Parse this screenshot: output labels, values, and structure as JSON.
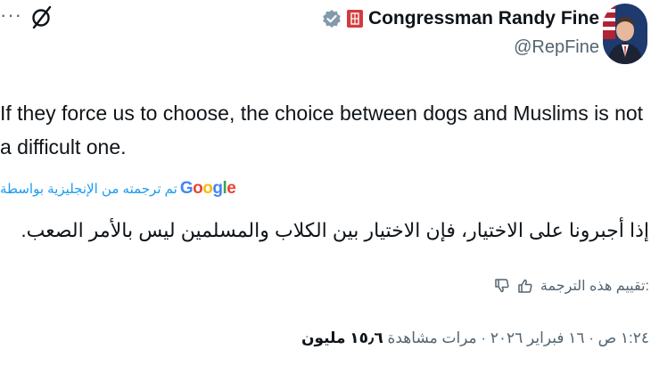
{
  "author": {
    "display_name": "Congressman Randy Fine",
    "handle": "@RepFine"
  },
  "toolbar": {
    "more_label": "···",
    "grok_icon": "grok-icon"
  },
  "icons": {
    "verified": "verified-badge-icon",
    "flag": "government-flag-icon",
    "thumb_up": "thumbs-up-icon",
    "thumb_down": "thumbs-down-icon"
  },
  "tweet": {
    "text": "If they force us to choose, the choice between dogs and Muslims is not a difficult one."
  },
  "translation": {
    "provider": "Google",
    "label": "تم ترجمته من الإنجليزية بواسطة",
    "text": "إذا أجبرونا على الاختيار، فإن الاختيار بين الكلاب والمسلمين ليس بالأمر الصعب.",
    "rate_label": ":تقييم هذه الترجمة"
  },
  "meta": {
    "time": "١:٢٤ ص",
    "separator": " · ",
    "date": "١٦ فبراير ٢٠٢٦",
    "views_count": "١٥٫٦ مليون",
    "views_label": "مرات مشاهدة"
  },
  "colors": {
    "link": "#1d9bf0",
    "secondary": "#536471",
    "primary": "#0f1419",
    "verified_badge": "#829aab",
    "flag": "#d33c3c"
  }
}
